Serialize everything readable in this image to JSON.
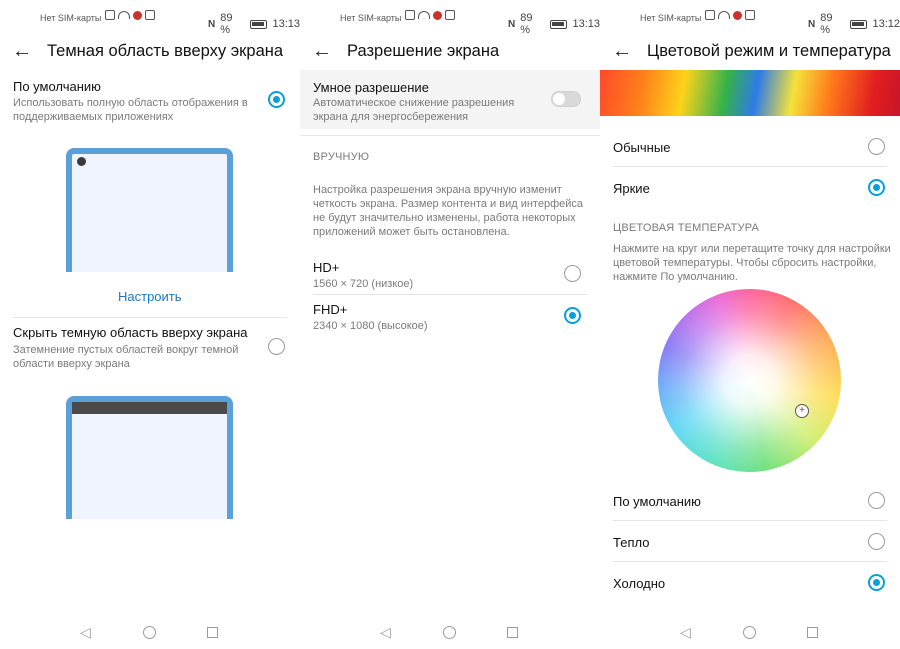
{
  "status": {
    "carrier": "Нет SIM-карты",
    "battery": "89 %",
    "times": [
      "13:13",
      "13:13",
      "13:12"
    ]
  },
  "accent_color": "#0a9fd6",
  "panel1": {
    "title": "Темная область вверху экрана",
    "option1": {
      "title": "По умолчанию",
      "desc": "Использовать полную область отображения в поддерживаемых приложениях",
      "selected": true
    },
    "customize": "Настроить",
    "option2": {
      "title": "Скрыть темную область вверху экрана",
      "desc": "Затемнение пустых областей вокруг темной области вверху экрана",
      "selected": false
    }
  },
  "panel2": {
    "title": "Разрешение экрана",
    "smart": {
      "title": "Умное разрешение",
      "desc": "Автоматическое снижение разрешения экрана для энергосбережения",
      "enabled": false
    },
    "section": "ВРУЧНУЮ",
    "info": "Настройка разрешения экрана вручную изменит четкость экрана. Размер контента и вид интерфейса не будут значительно изменены, работа некоторых приложений может быть остановлена.",
    "options": [
      {
        "title": "HD+",
        "sub": "1560 × 720 (низкое)",
        "selected": false
      },
      {
        "title": "FHD+",
        "sub": "2340 × 1080 (высокое)",
        "selected": true
      }
    ]
  },
  "panel3": {
    "title": "Цветовой режим и температура",
    "modes": [
      {
        "label": "Обычные",
        "selected": false
      },
      {
        "label": "Яркие",
        "selected": true
      }
    ],
    "section": "ЦВЕТОВАЯ ТЕМПЕРАТУРА",
    "info": "Нажмите на круг или перетащите точку для настройки цветовой температуры. Чтобы сбросить настройки, нажмите По умолчанию.",
    "temps": [
      {
        "label": "По умолчанию",
        "selected": false
      },
      {
        "label": "Тепло",
        "selected": false
      },
      {
        "label": "Холодно",
        "selected": true
      }
    ]
  }
}
